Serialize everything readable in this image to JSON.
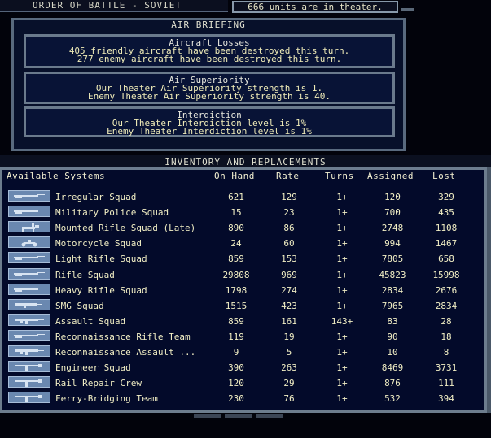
{
  "header": {
    "title": "ORDER OF BATTLE - SOVIET",
    "units": "666 units are in theater."
  },
  "air_briefing": {
    "title": "AIR BRIEFING",
    "aircraft_losses": {
      "title": "Aircraft Losses",
      "line1": "405 friendly aircraft have been destroyed this turn.",
      "line2": "277 enemy aircraft have been destroyed this turn."
    },
    "air_superiority": {
      "title": "Air Superiority",
      "line1": "Our Theater Air Superiority strength is 1.",
      "line2": "Enemy Theater Air Superiority strength is 40."
    },
    "interdiction": {
      "title": "Interdiction",
      "line1": "Our Theater Interdiction level is 1%",
      "line2": "Enemy Theater Interdiction level is 1%"
    }
  },
  "inventory": {
    "title": "INVENTORY AND REPLACEMENTS",
    "columns": {
      "systems": "Available Systems",
      "on_hand": "On Hand",
      "rate": "Rate",
      "turns": "Turns",
      "assigned": "Assigned",
      "lost": "Lost"
    },
    "rows": [
      {
        "icon": "rifle-icon",
        "name": "Irregular Squad",
        "on_hand": "621",
        "rate": "129",
        "turns": "1+",
        "assigned": "120",
        "lost": "329"
      },
      {
        "icon": "rifle-icon",
        "name": "Military Police Squad",
        "on_hand": "15",
        "rate": "23",
        "turns": "1+",
        "assigned": "700",
        "lost": "435"
      },
      {
        "icon": "horse-rider-icon",
        "name": "Mounted Rifle Squad (Late)",
        "on_hand": "890",
        "rate": "86",
        "turns": "1+",
        "assigned": "2748",
        "lost": "1108"
      },
      {
        "icon": "motorcycle-icon",
        "name": "Motorcycle Squad",
        "on_hand": "24",
        "rate": "60",
        "turns": "1+",
        "assigned": "994",
        "lost": "1467"
      },
      {
        "icon": "rifle-icon",
        "name": "Light Rifle Squad",
        "on_hand": "859",
        "rate": "153",
        "turns": "1+",
        "assigned": "7805",
        "lost": "658"
      },
      {
        "icon": "rifle-icon",
        "name": "Rifle Squad",
        "on_hand": "29808",
        "rate": "969",
        "turns": "1+",
        "assigned": "45823",
        "lost": "15998"
      },
      {
        "icon": "rifle-icon",
        "name": "Heavy Rifle Squad",
        "on_hand": "1798",
        "rate": "274",
        "turns": "1+",
        "assigned": "2834",
        "lost": "2676"
      },
      {
        "icon": "smg-icon",
        "name": "SMG Squad",
        "on_hand": "1515",
        "rate": "423",
        "turns": "1+",
        "assigned": "7965",
        "lost": "2834"
      },
      {
        "icon": "assault-rifle-icon",
        "name": "Assault Squad",
        "on_hand": "859",
        "rate": "161",
        "turns": "143+",
        "assigned": "83",
        "lost": "28"
      },
      {
        "icon": "rifle-icon",
        "name": "Reconnaissance Rifle Team",
        "on_hand": "119",
        "rate": "19",
        "turns": "1+",
        "assigned": "90",
        "lost": "18"
      },
      {
        "icon": "assault-rifle-icon",
        "name": "Reconnaissance Assault ...",
        "on_hand": "9",
        "rate": "5",
        "turns": "1+",
        "assigned": "10",
        "lost": "8"
      },
      {
        "icon": "engineer-icon",
        "name": "Engineer Squad",
        "on_hand": "390",
        "rate": "263",
        "turns": "1+",
        "assigned": "8469",
        "lost": "3731"
      },
      {
        "icon": "engineer-icon",
        "name": "Rail Repair Crew",
        "on_hand": "120",
        "rate": "29",
        "turns": "1+",
        "assigned": "876",
        "lost": "111"
      },
      {
        "icon": "engineer-icon",
        "name": "Ferry-Bridging Team",
        "on_hand": "230",
        "rate": "76",
        "turns": "1+",
        "assigned": "532",
        "lost": "394"
      }
    ]
  }
}
